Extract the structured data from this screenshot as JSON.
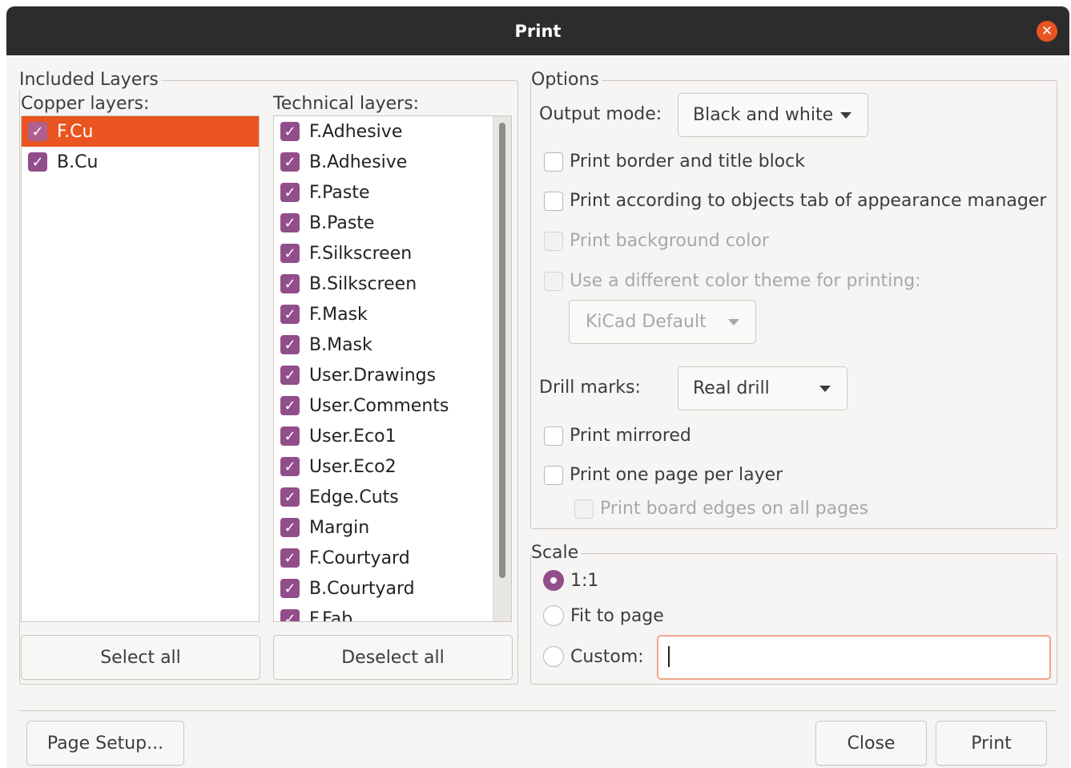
{
  "window": {
    "title": "Print"
  },
  "included_layers": {
    "title": "Included Layers",
    "copper_label": "Copper layers:",
    "technical_label": "Technical layers:",
    "copper": [
      {
        "label": "F.Cu",
        "checked": true,
        "selected": true
      },
      {
        "label": "B.Cu",
        "checked": true,
        "selected": false
      }
    ],
    "technical": [
      {
        "label": "F.Adhesive",
        "checked": true
      },
      {
        "label": "B.Adhesive",
        "checked": true
      },
      {
        "label": "F.Paste",
        "checked": true
      },
      {
        "label": "B.Paste",
        "checked": true
      },
      {
        "label": "F.Silkscreen",
        "checked": true
      },
      {
        "label": "B.Silkscreen",
        "checked": true
      },
      {
        "label": "F.Mask",
        "checked": true
      },
      {
        "label": "B.Mask",
        "checked": true
      },
      {
        "label": "User.Drawings",
        "checked": true
      },
      {
        "label": "User.Comments",
        "checked": true
      },
      {
        "label": "User.Eco1",
        "checked": true
      },
      {
        "label": "User.Eco2",
        "checked": true
      },
      {
        "label": "Edge.Cuts",
        "checked": true
      },
      {
        "label": "Margin",
        "checked": true
      },
      {
        "label": "F.Courtyard",
        "checked": true
      },
      {
        "label": "B.Courtyard",
        "checked": true
      },
      {
        "label": "F.Fab",
        "checked": true
      }
    ],
    "select_all": "Select all",
    "deselect_all": "Deselect all"
  },
  "options": {
    "title": "Options",
    "output_mode_label": "Output mode:",
    "output_mode_value": "Black and white",
    "print_border": "Print border and title block",
    "print_according": "Print according to objects tab of appearance manager",
    "print_background": "Print background color",
    "use_theme": "Use a different color theme for printing:",
    "theme_value": "KiCad Default",
    "drill_marks_label": "Drill marks:",
    "drill_marks_value": "Real drill",
    "print_mirrored": "Print mirrored",
    "one_page_per_layer": "Print one page per layer",
    "board_edges": "Print board edges on all pages"
  },
  "scale": {
    "title": "Scale",
    "one_to_one": "1:1",
    "fit_to_page": "Fit to page",
    "custom": "Custom:",
    "custom_value": "",
    "selected": "1:1"
  },
  "footer": {
    "page_setup": "Page Setup...",
    "close": "Close",
    "print": "Print"
  },
  "colors": {
    "accent": "#e95420",
    "check": "#924d8b",
    "titlebar": "#2c2c2c"
  }
}
